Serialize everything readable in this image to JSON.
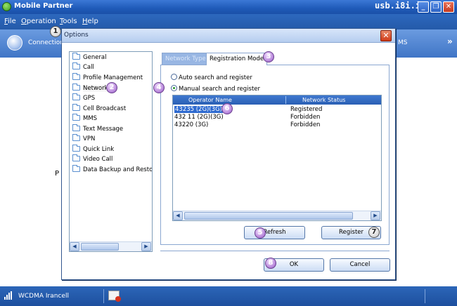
{
  "window": {
    "title": "Mobile Partner",
    "watermark": "usb.i8i.ir",
    "minimize": "_",
    "restore": "❐",
    "close": "✕"
  },
  "menu": {
    "file": "File",
    "operation": "Operation",
    "tools": "Tools",
    "help": "Help"
  },
  "toolbar": {
    "connection_label": "Connection",
    "sms_label": "MS",
    "more": "»"
  },
  "workarea": {
    "partial_text": "P"
  },
  "statusbar": {
    "network": "WCDMA Irancell"
  },
  "dialog": {
    "title": "Options",
    "close": "✕",
    "categories": [
      "General",
      "Call",
      "Profile Management",
      "Network",
      "GPS",
      "Cell Broadcast",
      "MMS",
      "Text Message",
      "VPN",
      "Quick Link",
      "Video Call",
      "Data Backup and Restora"
    ],
    "selected_category": "Network",
    "tabs": {
      "network_type": "Network Type",
      "registration_mode": "Registration Mode"
    },
    "radios": {
      "auto": "Auto search and register",
      "manual": "Manual search and register"
    },
    "columns": {
      "operator_name": "Operator Name",
      "network_status": "Network Status"
    },
    "operators": [
      {
        "name": "43235 (2G)(3G)",
        "status": "Registered"
      },
      {
        "name": "432 11 (2G)(3G)",
        "status": "Forbidden"
      },
      {
        "name": "43220 (3G)",
        "status": "Forbidden"
      }
    ],
    "buttons": {
      "refresh": "Refresh",
      "register": "Register",
      "ok": "OK",
      "cancel": "Cancel"
    }
  },
  "callouts": [
    "1",
    "2",
    "3",
    "4",
    "5",
    "6",
    "7",
    "8"
  ],
  "colors": {
    "title_blue": "#1f5ab8",
    "selection_blue": "#2e6ad0",
    "callout_purple": "#b27fd8",
    "close_red": "#cf3a17"
  }
}
